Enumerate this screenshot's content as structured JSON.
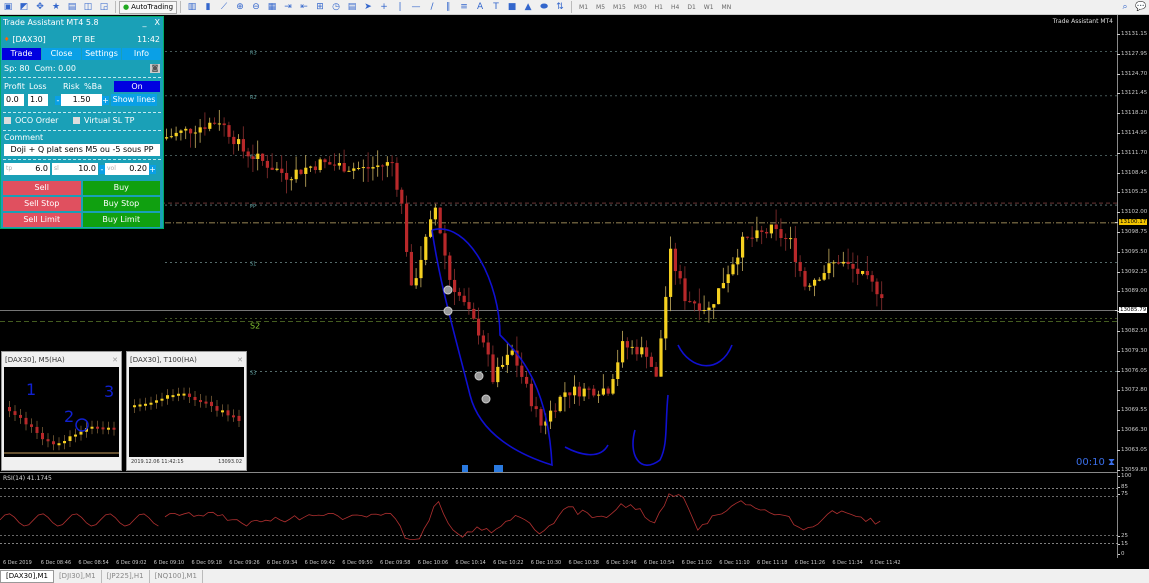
{
  "toolbar": {
    "autotrading": "AutoTrading",
    "timeframes": [
      "M1",
      "M5",
      "M15",
      "M30",
      "H1",
      "H4",
      "D1",
      "W1",
      "MN"
    ],
    "icons": [
      "new-chart-icon",
      "profiles-icon",
      "crosshair-icon",
      "market-watch-icon",
      "navigator-icon",
      "terminal-icon",
      "strategy-tester-icon",
      "autotrading-icon",
      "bar-chart-icon",
      "candlestick-icon",
      "line-chart-icon",
      "zoom-in-icon",
      "zoom-out-icon",
      "tile-windows-icon",
      "autoscroll-icon",
      "chart-shift-icon",
      "indicators-icon",
      "periods-icon",
      "templates-icon",
      "cursor-icon",
      "crosshair-tool-icon",
      "vertical-line-icon",
      "horizontal-line-icon",
      "trendline-icon",
      "fibonacci-icon",
      "channel-icon",
      "text-icon",
      "label-icon",
      "rectangle-icon",
      "triangle-icon",
      "ellipse-icon",
      "arrows-icon"
    ]
  },
  "panel": {
    "title": "Trade Assistant MT4 5.8",
    "close": "X",
    "minimize": "_",
    "symbol": "[DAX30]",
    "mode": "PT BE",
    "time": "11:42",
    "tabs": [
      "Trade",
      "Close",
      "Settings",
      "Info"
    ],
    "spread": "Sp: 80",
    "commission": "Com: 0.00",
    "profit_label": "Profit",
    "loss_label": "Loss",
    "risk_label": "Risk",
    "pctba_label": "%Ba",
    "on_label": "On",
    "profit": "0.0",
    "loss": "1.0",
    "risk": "1.50",
    "minus": "-",
    "plus": "+",
    "show_lines": "Show lines",
    "oco": "OCO Order",
    "virtual": "Virtual SL TP",
    "comment_label": "Comment",
    "comment": "Doji + Q plat sens M5 ou -5 sous PP",
    "tp_ph": "tp",
    "tp": "6.0",
    "sl_ph": "sl",
    "sl": "10.0",
    "vol_ph": "vol",
    "vol": "0.20",
    "buttons": {
      "sell": "Sell",
      "buy": "Buy",
      "sell_stop": "Sell Stop",
      "buy_stop": "Buy Stop",
      "sell_limit": "Sell Limit",
      "buy_limit": "Buy Limit"
    }
  },
  "chart": {
    "watermark": "Trade Assistant MT4",
    "countdown": "00:10",
    "pivots": [
      {
        "label": "R3",
        "price": 13128.3
      },
      {
        "label": "R2",
        "price": 13121.0
      },
      {
        "label": "R1",
        "price": 13111.2
      },
      {
        "label": "PP",
        "price": 13103.1
      },
      {
        "label": "S1",
        "price": 13093.7
      },
      {
        "label": "S2",
        "price": 13084.5
      },
      {
        "label": "S3",
        "price": 13075.8
      }
    ],
    "bid": "13085.79",
    "bid_price": 13085.79,
    "ask": "13100.17",
    "ask_price": 13100.17,
    "keypoints": [
      [
        0,
        13114
      ],
      [
        12,
        13117
      ],
      [
        17,
        13112
      ],
      [
        26,
        13108
      ],
      [
        33,
        13110
      ],
      [
        42,
        13109
      ],
      [
        48,
        13110
      ],
      [
        50,
        13103
      ],
      [
        52,
        13089
      ],
      [
        57,
        13102.7
      ],
      [
        60,
        13091
      ],
      [
        67,
        13081
      ],
      [
        69,
        13074.5
      ],
      [
        73,
        13079
      ],
      [
        79,
        13067
      ],
      [
        84,
        13072.5
      ],
      [
        93,
        13073
      ],
      [
        96,
        13080
      ],
      [
        101,
        13079
      ],
      [
        103,
        13074.5
      ],
      [
        106,
        13095
      ],
      [
        109,
        13088
      ],
      [
        114,
        13086
      ],
      [
        121,
        13097
      ],
      [
        127,
        13099
      ],
      [
        131,
        13097
      ],
      [
        134,
        13090
      ],
      [
        141,
        13094
      ],
      [
        145,
        13092
      ],
      [
        150,
        13088.6
      ]
    ],
    "rsi_label": "RSI(14) 41.1745",
    "rsi_levels": [
      "100",
      "85",
      "75",
      "25",
      "15",
      "0"
    ]
  },
  "price_scale": [
    "13131.15",
    "13127.95",
    "13124.70",
    "13121.45",
    "13118.20",
    "13114.95",
    "13111.70",
    "13108.45",
    "13105.25",
    "13102.00",
    "13098.75",
    "13095.50",
    "13092.25",
    "13089.00",
    "13085.79",
    "13082.50",
    "13079.30",
    "13076.05",
    "13072.80",
    "13069.55",
    "13066.30",
    "13063.05",
    "13059.80"
  ],
  "time_axis": [
    "6 Dec 2019",
    "6 Dec 08:46",
    "6 Dec 08:54",
    "6 Dec 09:02",
    "6 Dec 09:10",
    "6 Dec 09:18",
    "6 Dec 09:26",
    "6 Dec 09:34",
    "6 Dec 09:42",
    "6 Dec 09:50",
    "6 Dec 09:58",
    "6 Dec 10:06",
    "6 Dec 10:14",
    "6 Dec 10:22",
    "6 Dec 10:30",
    "6 Dec 10:38",
    "6 Dec 10:46",
    "6 Dec 10:54",
    "6 Dec 11:02",
    "6 Dec 11:10",
    "6 Dec 11:18",
    "6 Dec 11:26",
    "6 Dec 11:34",
    "6 Dec 11:42"
  ],
  "mini": [
    {
      "title": "[DAX30], M5(HA)",
      "annotations": [
        "1",
        "2",
        "3"
      ]
    },
    {
      "title": "[DAX30], T100(HA)",
      "footer_time": "2019.12.06 11:42:15",
      "footer_price": "13093.02"
    }
  ],
  "tabs": [
    "[DAX30],M1",
    "[DJI30],M1",
    "[JP225],H1",
    "[NQ100],M1"
  ]
}
